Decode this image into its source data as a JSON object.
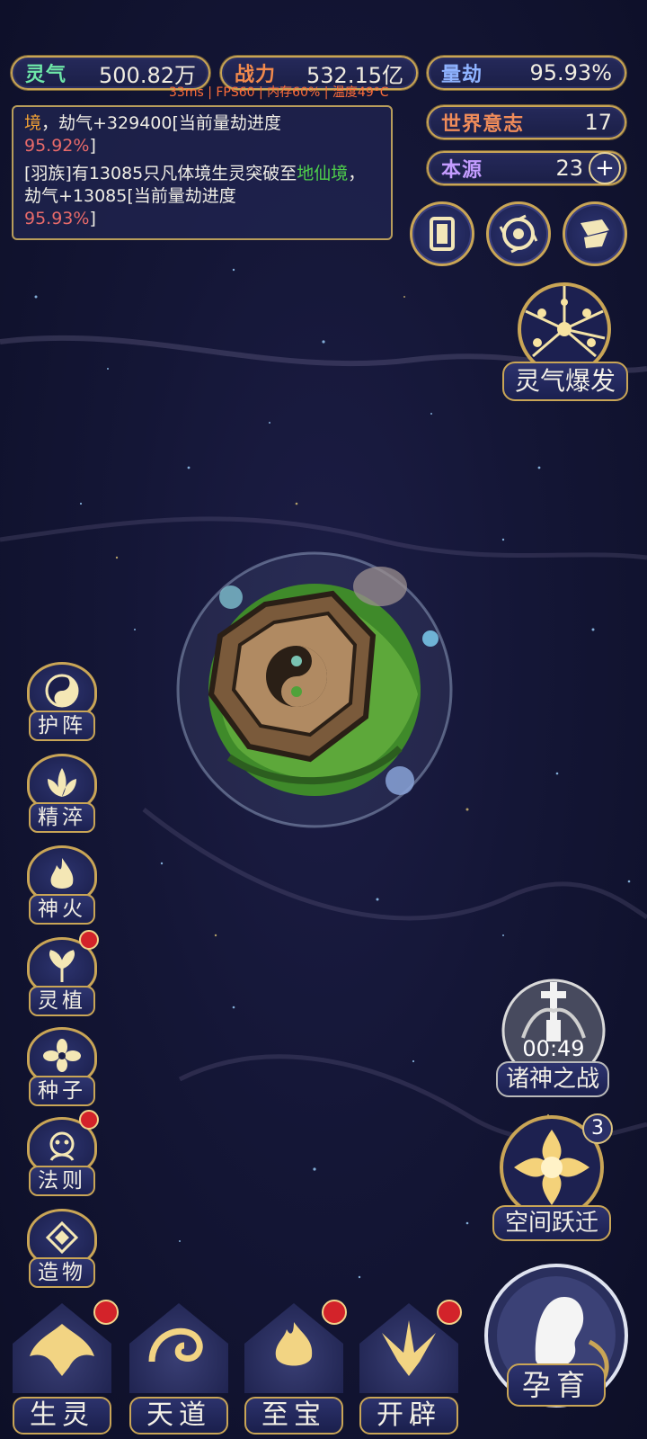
{
  "hud": {
    "lingqi": {
      "label": "灵气",
      "value": "500.82万"
    },
    "zhanli": {
      "label": "战力",
      "value": "532.15亿"
    },
    "liangjie": {
      "label": "量劫",
      "value": "95.93%"
    },
    "shijie": {
      "label": "世界意志",
      "value": "17"
    },
    "benyuan": {
      "label": "本源",
      "value": "23"
    },
    "fps_overlay": "33ms | FPS60 | 内存60% | 温度49°C"
  },
  "log": {
    "line1": {
      "a": "境",
      "b": "，劫气+329400[当前量劫进度",
      "c": "95.92%",
      "d": "]"
    },
    "line2": {
      "a": "[羽族]有13085只凡体境生灵突破至",
      "b": "地仙境",
      "c": "，劫气+13085[当前量劫进度",
      "d": "95.93%",
      "e": "]"
    }
  },
  "right": {
    "burst_label": "灵气爆发",
    "battle_timer": "00:49",
    "battle_label": "诸神之战",
    "leap_label": "空间跃迁",
    "leap_badge": "3",
    "incubate_label": "孕育"
  },
  "left_menu": [
    {
      "label": "护阵"
    },
    {
      "label": "精淬"
    },
    {
      "label": "神火"
    },
    {
      "label": "灵植"
    },
    {
      "label": "种子"
    },
    {
      "label": "法则"
    },
    {
      "label": "造物"
    }
  ],
  "bottom_menu": [
    {
      "label": "生灵"
    },
    {
      "label": "天道"
    },
    {
      "label": "至宝"
    },
    {
      "label": "开辟"
    }
  ],
  "colors": {
    "gold": "#c9a556",
    "red_dot": "#d3232a",
    "panel": "#25295a"
  }
}
